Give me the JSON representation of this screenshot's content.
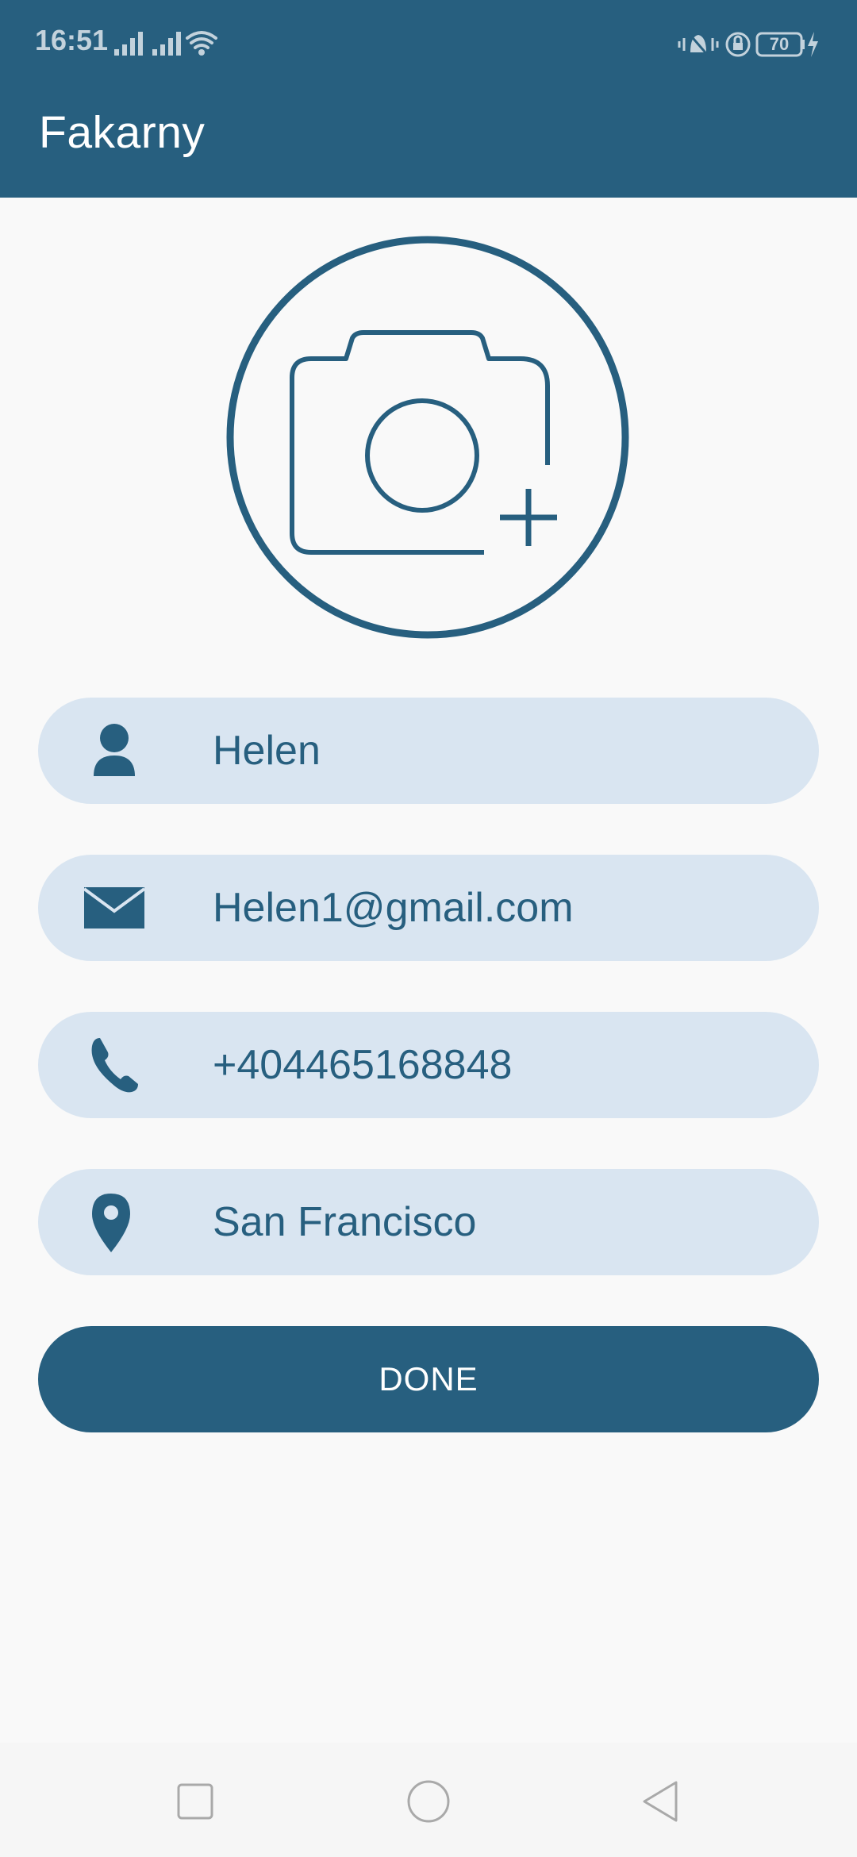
{
  "status_bar": {
    "time": "16:51",
    "battery": "70"
  },
  "app_bar": {
    "title": "Fakarny"
  },
  "avatar": {
    "icon": "camera-plus-icon"
  },
  "form": {
    "name": {
      "value": "Helen",
      "icon": "person-icon"
    },
    "email": {
      "value": "Helen1@gmail.com",
      "icon": "mail-icon"
    },
    "phone": {
      "value": "+404465168848",
      "icon": "phone-icon"
    },
    "location": {
      "value": "San Francisco",
      "icon": "location-pin-icon"
    }
  },
  "done_label": "DONE",
  "colors": {
    "primary": "#275f7f",
    "field_bg": "#d9e5f1",
    "background": "#f9f9f9"
  }
}
